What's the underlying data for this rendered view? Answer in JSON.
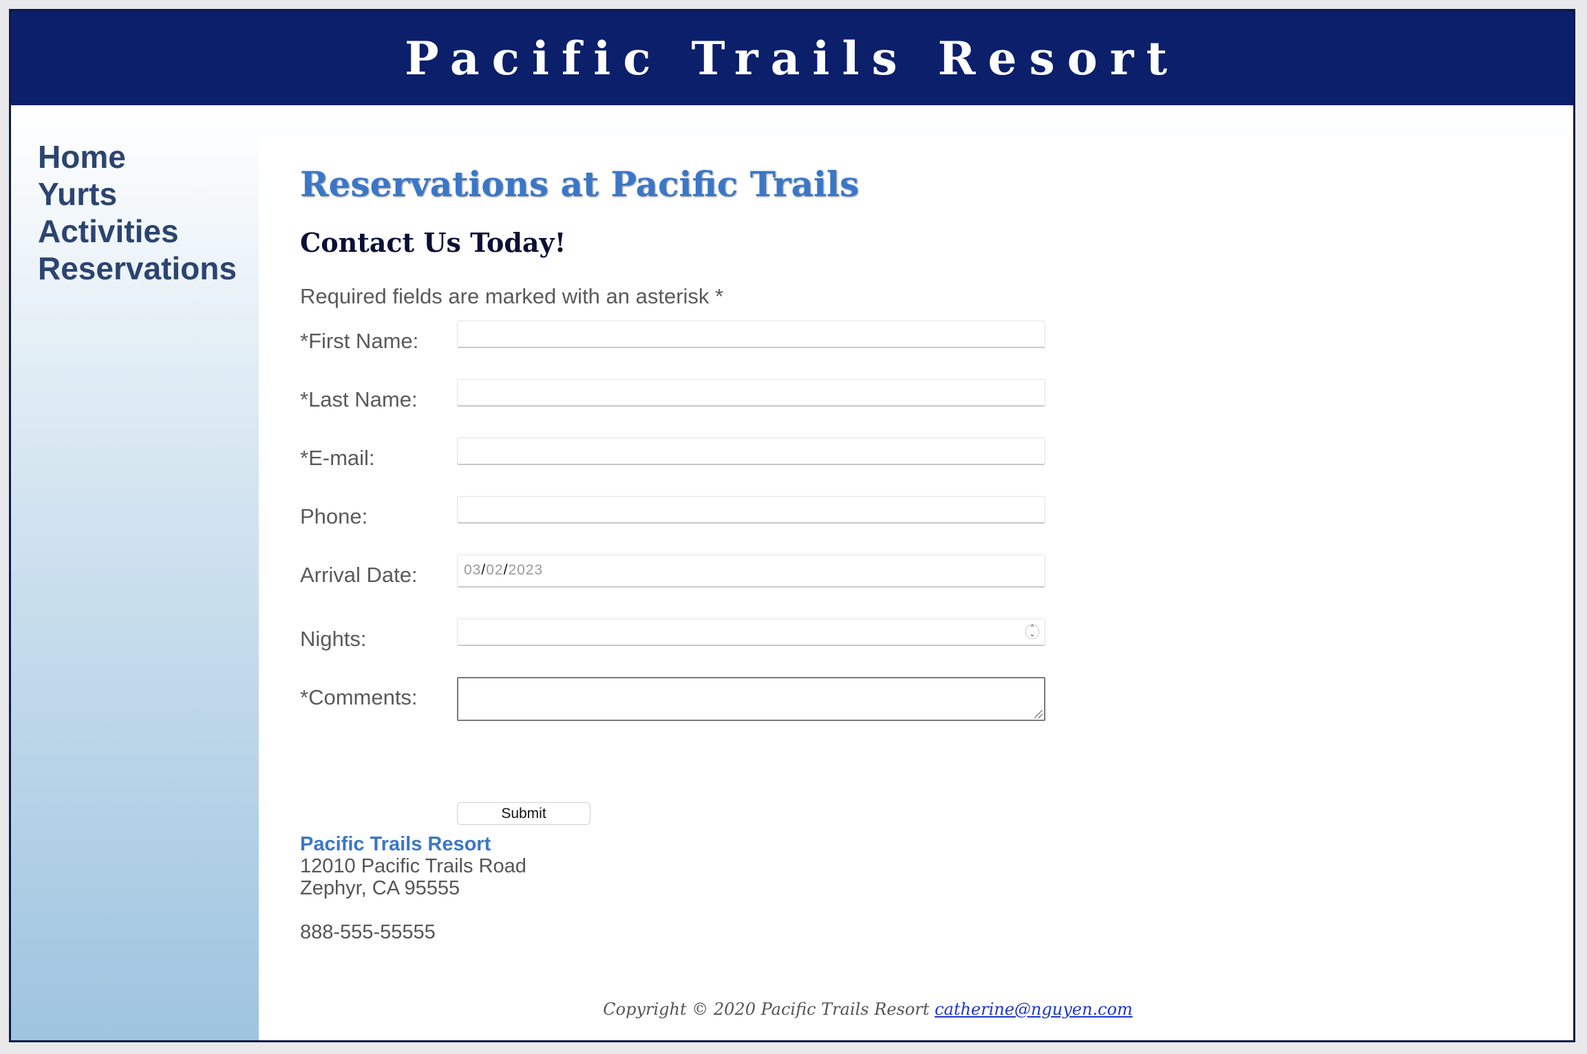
{
  "header": {
    "title": "Pacific Trails Resort"
  },
  "nav": {
    "items": [
      "Home",
      "Yurts",
      "Activities",
      "Reservations"
    ]
  },
  "main": {
    "heading": "Reservations at Pacific Trails",
    "subheading": "Contact Us Today!",
    "required_note": "Required fields are marked with an asterisk *",
    "form": {
      "first_name_label": "*First Name:",
      "last_name_label": "*Last Name:",
      "email_label": "*E-mail:",
      "phone_label": "Phone:",
      "arrival_label": "Arrival Date:",
      "arrival_value": {
        "month": "03",
        "day": "02",
        "year": "2023",
        "separator": "/"
      },
      "nights_label": "Nights:",
      "comments_label": "*Comments:",
      "submit_label": "Submit"
    },
    "address": {
      "name": "Pacific Trails Resort",
      "street": "12010 Pacific Trails Road",
      "city": "Zephyr, CA 95555",
      "phone": "888-555-55555"
    }
  },
  "footer": {
    "copyright": "Copyright © 2020 Pacific Trails Resort",
    "email": "catherine@nguyen.com"
  }
}
